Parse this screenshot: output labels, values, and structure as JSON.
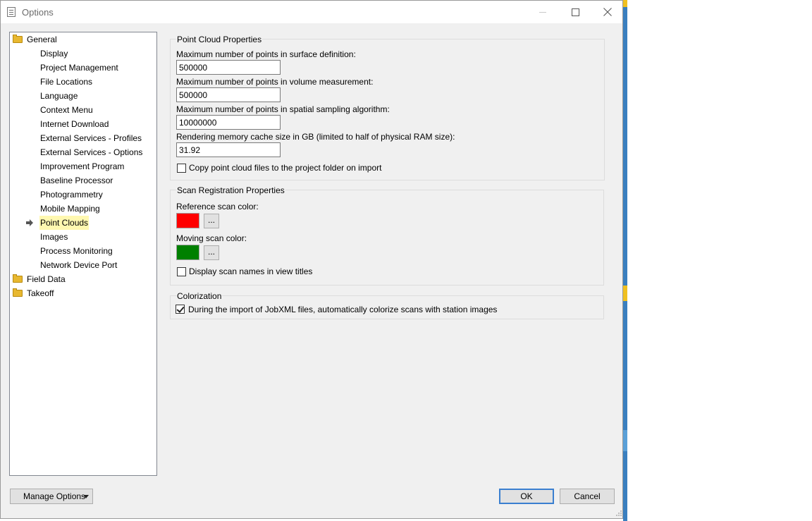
{
  "window": {
    "title": "Options"
  },
  "tree": {
    "general": "General",
    "children": [
      "Display",
      "Project Management",
      "File Locations",
      "Language",
      "Context Menu",
      "Internet Download",
      "External Services - Profiles",
      "External Services - Options",
      "Improvement Program",
      "Baseline Processor",
      "Photogrammetry",
      "Mobile Mapping",
      "Point Clouds",
      "Images",
      "Process Monitoring",
      "Network Device Port"
    ],
    "selected": "Point Clouds",
    "field_data": "Field Data",
    "takeoff": "Takeoff"
  },
  "point_cloud": {
    "title": "Point Cloud Properties",
    "surface_label": "Maximum number of points in surface definition:",
    "surface_value": "500000",
    "volume_label": "Maximum number of points in volume measurement:",
    "volume_value": "500000",
    "sampling_label": "Maximum number of points in spatial sampling algorithm:",
    "sampling_value": "10000000",
    "cache_label": "Rendering memory cache size in GB (limited to half of physical RAM size):",
    "cache_value": "31.92",
    "copy_label": "Copy point cloud files to the project folder on import",
    "copy_checked": false
  },
  "scan_registration": {
    "title": "Scan Registration Properties",
    "reference_label": "Reference scan color:",
    "reference_color": "#ff0000",
    "moving_label": "Moving scan color:",
    "moving_color": "#008000",
    "dots": "...",
    "display_names_label": "Display scan names in view titles",
    "display_names_checked": false
  },
  "colorization": {
    "title": "Colorization",
    "auto_label": "During the import of JobXML files, automatically colorize scans with station images",
    "auto_checked": true
  },
  "footer": {
    "manage_options": "Manage Options",
    "ok": "OK",
    "cancel": "Cancel"
  }
}
